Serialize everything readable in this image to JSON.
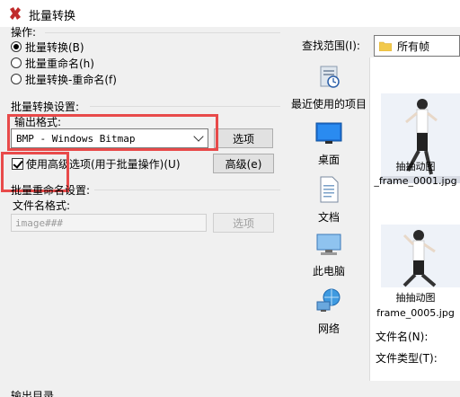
{
  "window": {
    "title": "批量转换"
  },
  "operation": {
    "legend": "操作:",
    "options": [
      {
        "label": "批量转换(B)",
        "selected": true
      },
      {
        "label": "批量重命名(h)",
        "selected": false
      },
      {
        "label": "批量转换-重命名(f)",
        "selected": false
      }
    ]
  },
  "convert_settings": {
    "legend": "批量转换设置:",
    "output_format_label": "输出格式:",
    "output_format_value": "BMP - Windows Bitmap",
    "options_button": "选项",
    "use_advanced_label": "使用高级选项(用于批量操作)(U)",
    "use_advanced_checked": true,
    "advanced_button": "高级(e)"
  },
  "rename_settings": {
    "legend": "批量重命名设置:",
    "filename_pattern_label": "文件名格式:",
    "filename_pattern_value": "image###",
    "options_button": "选项"
  },
  "output_dir": {
    "legend": "输出目录"
  },
  "file_dialog": {
    "look_in_label": "查找范围(I):",
    "look_in_value": "所有帧",
    "places": [
      {
        "label": "最近使用的项目",
        "icon": "recent-items-icon"
      },
      {
        "label": "桌面",
        "icon": "desktop-icon"
      },
      {
        "label": "文档",
        "icon": "documents-icon"
      },
      {
        "label": "此电脑",
        "icon": "this-pc-icon"
      },
      {
        "label": "网络",
        "icon": "network-icon"
      }
    ],
    "files": [
      {
        "line1": "抽抽动图",
        "line2": "_frame_0001.jpg"
      },
      {
        "line1": "抽抽动图",
        "line2": "frame_0005.jpg"
      }
    ],
    "filename_label": "文件名(N):",
    "filetype_label": "文件类型(T):"
  },
  "colors": {
    "highlight_border": "#e84a4a",
    "folder": "#f2c94c",
    "accent_blue": "#1e73d8"
  }
}
